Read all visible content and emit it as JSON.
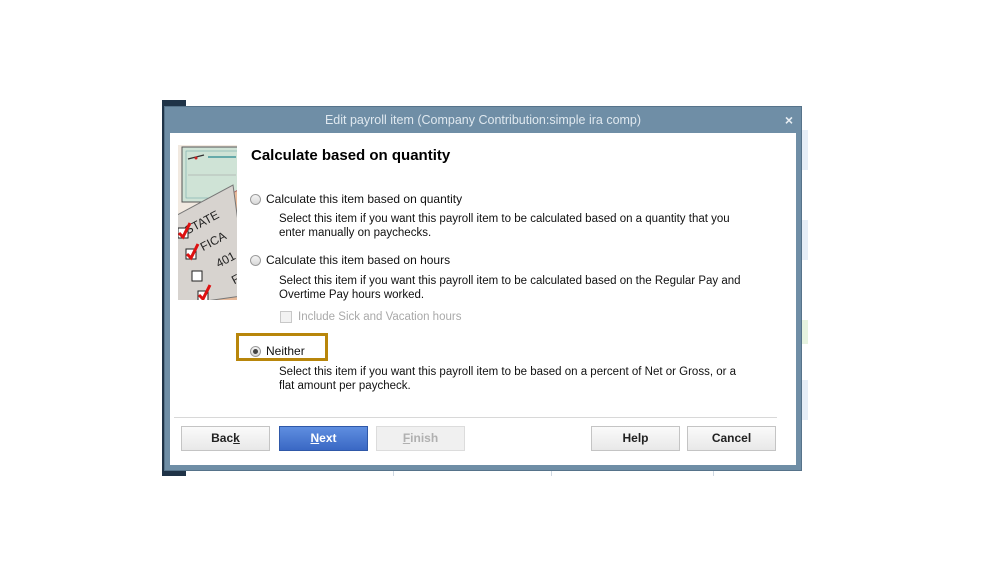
{
  "dialog": {
    "title": "Edit payroll item (Company Contribution:simple ira comp)",
    "close_label": "×",
    "heading": "Calculate based on quantity",
    "art_labels": [
      "STATE",
      "FICA",
      "401",
      "F"
    ],
    "options": [
      {
        "label": "Calculate this item based on quantity",
        "description": "Select this item if you want this payroll item to be calculated based on a quantity that you enter manually on paychecks.",
        "selected": false
      },
      {
        "label": "Calculate this item based on hours",
        "description": "Select this item if you want this payroll item to be calculated based on the Regular Pay and Overtime Pay hours worked.",
        "selected": false
      },
      {
        "label": "Neither",
        "description": "Select this item if you want this payroll item to be based on a percent of Net or Gross, or a flat amount per paycheck.",
        "selected": true
      }
    ],
    "include_sick_vacation": {
      "label": "Include Sick and Vacation hours",
      "checked": false,
      "enabled": false
    },
    "buttons": {
      "back": {
        "pre": "Bac",
        "mn": "k",
        "post": ""
      },
      "next": {
        "pre": "",
        "mn": "N",
        "post": "ext"
      },
      "finish": {
        "pre": "",
        "mn": "F",
        "post": "inish",
        "enabled": false
      },
      "help": "Help",
      "cancel": "Cancel"
    },
    "highlight_color": "#b8860b",
    "titlebar_color": "#6f8ea6",
    "primary_button_color": "#3a68c4"
  }
}
